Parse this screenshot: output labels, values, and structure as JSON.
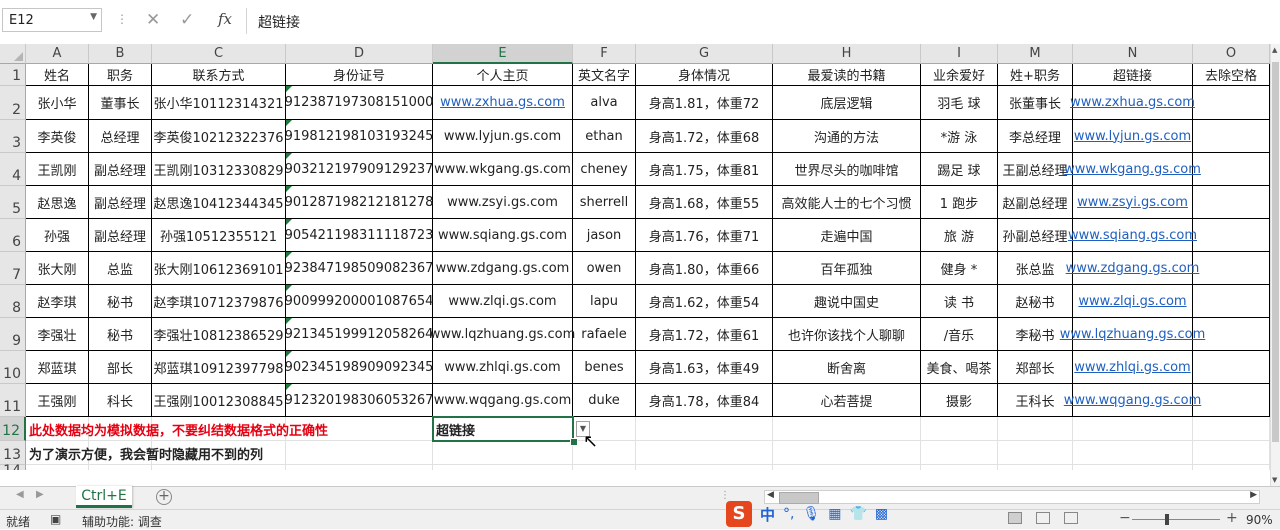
{
  "formula_bar": {
    "name_box": "E12",
    "content": "超链接",
    "fx_label": "fx"
  },
  "columns": [
    "A",
    "B",
    "C",
    "D",
    "E",
    "F",
    "G",
    "H",
    "I",
    "M",
    "N",
    "O"
  ],
  "selected_column": "E",
  "rows": [
    "1",
    "2",
    "3",
    "4",
    "5",
    "6",
    "7",
    "8",
    "9",
    "10",
    "11",
    "12",
    "13",
    "14"
  ],
  "selected_row": "12",
  "table": {
    "headers": [
      "姓名",
      "职务",
      "联系方式",
      "身份证号",
      "个人主页",
      "英文名字",
      "身体情况",
      "最爱读的书籍",
      "业余爱好",
      "姓+职务",
      "超链接",
      "去除空格"
    ],
    "rows": [
      [
        "张小华",
        "董事长",
        "张小华10112314321",
        "912387197308151000",
        "www.zxhua.gs.com",
        "alva",
        "身高1.81，体重72",
        "底层逻辑",
        "羽毛  球",
        "张董事长",
        "www.zxhua.gs.com",
        ""
      ],
      [
        "李英俊",
        "总经理",
        "李英俊10212322376",
        "919812198103193245",
        "www.lyjun.gs.com",
        "ethan",
        "身高1.72，体重68",
        "沟通的方法",
        "*游  泳",
        "李总经理",
        "www.lyjun.gs.com",
        ""
      ],
      [
        "王凯刚",
        "副总经理",
        "王凯刚10312330829",
        "903212197909129237",
        "www.wkgang.gs.com",
        "cheney",
        "身高1.75，体重81",
        "世界尽头的咖啡馆",
        "踢足  球",
        "王副总经理",
        "www.wkgang.gs.com",
        ""
      ],
      [
        "赵思逸",
        "副总经理",
        "赵思逸10412344345",
        "901287198212181278",
        "www.zsyi.gs.com",
        "sherrell",
        "身高1.68，体重55",
        "高效能人士的七个习惯",
        "1 跑步",
        "赵副总经理",
        "www.zsyi.gs.com",
        ""
      ],
      [
        "孙强",
        "副总经理",
        "孙强10512355121",
        "905421198311118723",
        "www.sqiang.gs.com",
        "jason",
        "身高1.76，体重71",
        "走遍中国",
        "旅  游",
        "孙副总经理",
        "www.sqiang.gs.com",
        ""
      ],
      [
        "张大刚",
        "总监",
        "张大刚10612369101",
        "923847198509082367",
        "www.zdgang.gs.com",
        "owen",
        "身高1.80，体重66",
        "百年孤独",
        "健身 *",
        "张总监",
        "www.zdgang.gs.com",
        ""
      ],
      [
        "赵李琪",
        "秘书",
        "赵李琪10712379876",
        "900999200001087654",
        "www.zlqi.gs.com",
        "lapu",
        "身高1.62，体重54",
        "趣说中国史",
        "读  书",
        "赵秘书",
        "www.zlqi.gs.com",
        ""
      ],
      [
        "李强壮",
        "秘书",
        "李强壮10812386529",
        "921345199912058264",
        "www.lqzhuang.gs.com",
        "rafaele",
        "身高1.72，体重61",
        "也许你该找个人聊聊",
        "/音乐",
        "李秘书",
        "www.lqzhuang.gs.com",
        ""
      ],
      [
        "郑蓝琪",
        "部长",
        "郑蓝琪10912397798",
        "902345198909092345",
        "www.zhlqi.gs.com",
        "benes",
        "身高1.63，体重49",
        "断舍离",
        "美食、喝茶",
        "郑部长",
        "www.zhlqi.gs.com",
        ""
      ],
      [
        "王强刚",
        "科长",
        "王强刚10012308845",
        "912320198306053267",
        "www.wqgang.gs.com",
        "duke",
        "身高1.78，体重84",
        "心若菩提",
        "摄影",
        "王科长",
        "www.wqgang.gs.com",
        ""
      ]
    ]
  },
  "notes": {
    "row12_note": "此处数据均为模拟数据，不要纠结数据格式的正确性",
    "row12_e": "超链接",
    "row13_note": "为了演示方便，我会暂时隐藏用不到的列"
  },
  "sheet_tab": "Ctrl+E",
  "status": {
    "ready": "就绪",
    "accessibility": "辅助功能: 调查",
    "zoom": "90%",
    "ime_logo": "S",
    "ime_lang": "中"
  },
  "colors": {
    "accent": "#217346",
    "link": "#1f5fbf",
    "note_red": "#e60012"
  }
}
